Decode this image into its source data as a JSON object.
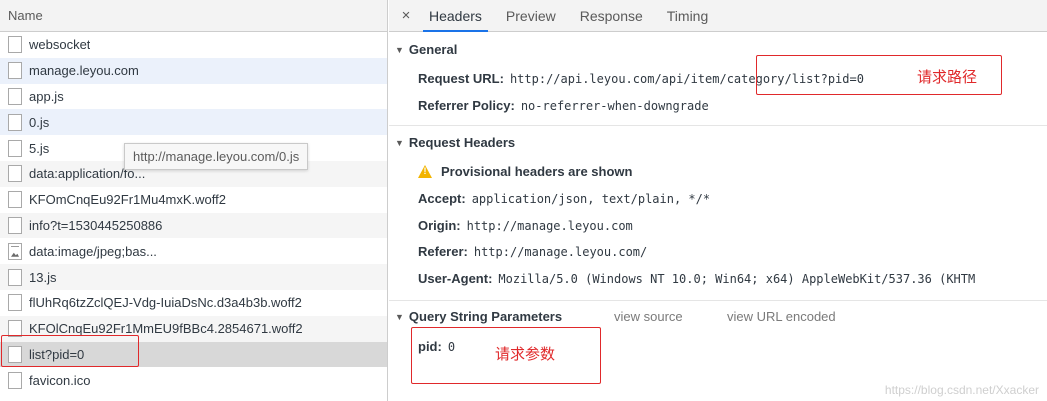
{
  "request_list": {
    "header": "Name",
    "items": [
      {
        "name": "websocket",
        "icon": "file-icon"
      },
      {
        "name": "manage.leyou.com",
        "icon": "file-icon"
      },
      {
        "name": "app.js",
        "icon": "file-icon"
      },
      {
        "name": "0.js",
        "icon": "file-icon"
      },
      {
        "name": "5.js",
        "icon": "file-icon"
      },
      {
        "name": "data:application/fo...",
        "icon": "file-icon"
      },
      {
        "name": "KFOmCnqEu92Fr1Mu4mxK.woff2",
        "icon": "file-icon"
      },
      {
        "name": "info?t=1530445250886",
        "icon": "file-icon"
      },
      {
        "name": "data:image/jpeg;bas...",
        "icon": "image-icon"
      },
      {
        "name": "13.js",
        "icon": "file-icon"
      },
      {
        "name": "flUhRq6tzZclQEJ-Vdg-IuiaDsNc.d3a4b3b.woff2",
        "icon": "file-icon"
      },
      {
        "name": "KFOlCnqEu92Fr1MmEU9fBBc4.2854671.woff2",
        "icon": "file-icon"
      },
      {
        "name": "list?pid=0",
        "icon": "file-icon"
      },
      {
        "name": "favicon.ico",
        "icon": "file-icon"
      }
    ],
    "tooltip": "http://manage.leyou.com/0.js"
  },
  "detail": {
    "close_symbol": "×",
    "tabs": [
      {
        "label": "Headers",
        "active": true
      },
      {
        "label": "Preview",
        "active": false
      },
      {
        "label": "Response",
        "active": false
      },
      {
        "label": "Timing",
        "active": false
      }
    ],
    "general": {
      "title": "General",
      "request_url_label": "Request URL:",
      "request_url_value": "http://api.leyou.com/api/item/category/list?pid=0",
      "referrer_policy_label": "Referrer Policy:",
      "referrer_policy_value": "no-referrer-when-downgrade"
    },
    "request_headers": {
      "title": "Request Headers",
      "warning": "Provisional headers are shown",
      "accept_label": "Accept:",
      "accept_value": "application/json, text/plain, */*",
      "origin_label": "Origin:",
      "origin_value": "http://manage.leyou.com",
      "referer_label": "Referer:",
      "referer_value": "http://manage.leyou.com/",
      "user_agent_label": "User-Agent:",
      "user_agent_value": "Mozilla/5.0 (Windows NT 10.0; Win64; x64) AppleWebKit/537.36 (KHTM"
    },
    "query_string": {
      "title": "Query String Parameters",
      "view_source": "view source",
      "view_url_encoded": "view URL encoded",
      "pid_label": "pid:",
      "pid_value": "0"
    }
  },
  "annotations": {
    "path_label": "请求路径",
    "params_label": "请求参数",
    "color": "#e0292b"
  },
  "watermark": "https://blog.csdn.net/Xxacker",
  "colors": {
    "row_hover": "#ebf1fb",
    "row_selected": "#d8d8d8",
    "tab_active_underline": "#1a73e8",
    "warning": "#f2b400"
  }
}
